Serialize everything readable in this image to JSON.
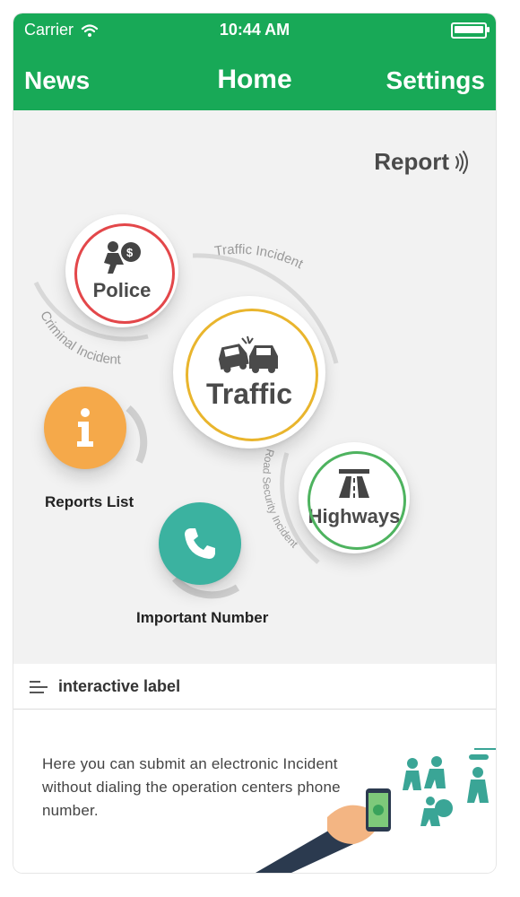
{
  "status_bar": {
    "carrier": "Carrier",
    "time": "10:44 AM"
  },
  "nav": {
    "left": "News",
    "title": "Home",
    "right": "Settings"
  },
  "report": {
    "label": "Report"
  },
  "categories": {
    "police": "Police",
    "traffic": "Traffic",
    "highways": "Highways",
    "traffic_incident": "Traffic Incident",
    "criminal_incident": "Criminal Incident",
    "road_security_incident": "Road Security Incident"
  },
  "shortcuts": {
    "reports_list": "Reports List",
    "important_number": "Important Number"
  },
  "interactive_label": {
    "text": "interactive label"
  },
  "description": {
    "text": "Here you can submit an electronic Incident without dialing the operation centers phone number."
  },
  "colors": {
    "brand_green": "#18a957",
    "police_red": "#e3474a",
    "traffic_yellow": "#e9b52d",
    "highways_green": "#4eb35f",
    "info_orange": "#f5a94a",
    "phone_teal": "#3bb2a0"
  },
  "icons": {
    "report": "radio-waves-icon",
    "police": "thief-moneybag-icon",
    "traffic": "car-crash-icon",
    "highways": "highway-road-icon",
    "reports_list": "info-icon",
    "important_number": "phone-icon",
    "menu": "menu-lines-icon"
  }
}
